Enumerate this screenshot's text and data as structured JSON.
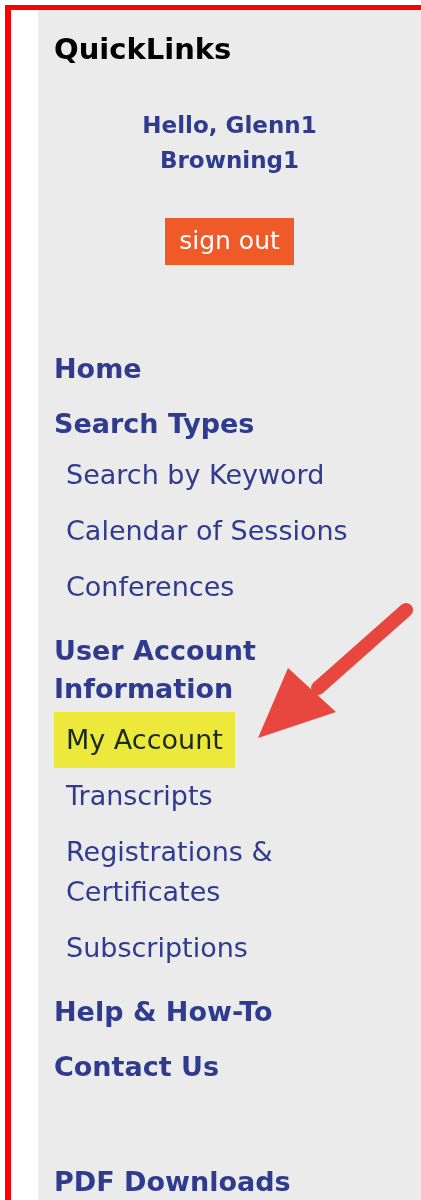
{
  "sidebar": {
    "title": "QuickLinks",
    "greeting": "Hello, Glenn1 Browning1",
    "sign_out": "sign out",
    "sections": [
      {
        "heading": "Home"
      },
      {
        "heading": "Search Types",
        "items": [
          {
            "label": "Search by Keyword",
            "highlighted": false
          },
          {
            "label": "Calendar of Sessions",
            "highlighted": false
          },
          {
            "label": "Conferences",
            "highlighted": false
          }
        ]
      },
      {
        "heading": "User Account Information",
        "items": [
          {
            "label": "My Account",
            "highlighted": true
          },
          {
            "label": "Transcripts",
            "highlighted": false
          },
          {
            "label": "Registrations & Certificates",
            "highlighted": false
          },
          {
            "label": "Subscriptions",
            "highlighted": false
          }
        ]
      },
      {
        "heading": "Help & How-To"
      },
      {
        "heading": "Contact Us"
      }
    ],
    "downloads": {
      "heading": "PDF Downloads"
    }
  }
}
